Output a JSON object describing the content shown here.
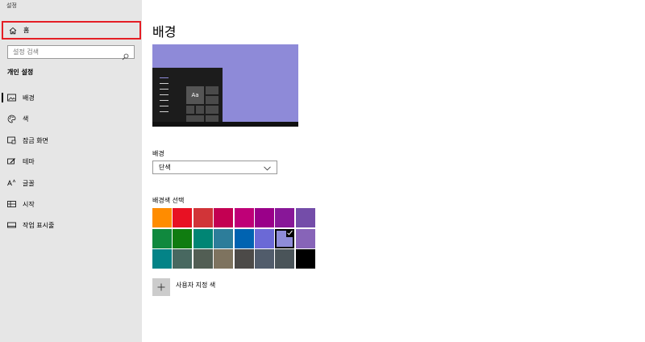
{
  "app": {
    "title": "설정"
  },
  "sidebar": {
    "home_label": "홈",
    "search_placeholder": "설정 검색",
    "section_title": "개인 설정",
    "items": [
      {
        "label": "배경",
        "icon": "picture-icon",
        "active": true
      },
      {
        "label": "색",
        "icon": "palette-icon",
        "active": false
      },
      {
        "label": "잠금 화면",
        "icon": "lock-screen-icon",
        "active": false
      },
      {
        "label": "테마",
        "icon": "theme-icon",
        "active": false
      },
      {
        "label": "글꼴",
        "icon": "font-icon",
        "active": false
      },
      {
        "label": "시작",
        "icon": "start-icon",
        "active": false
      },
      {
        "label": "작업 표시줄",
        "icon": "taskbar-icon",
        "active": false
      }
    ]
  },
  "main": {
    "title": "배경",
    "preview": {
      "sample_text": "Aa",
      "background_color": "#8e8ad8"
    },
    "background": {
      "label": "배경",
      "selected_value": "단색"
    },
    "color_choice": {
      "label": "배경색 선택",
      "colors": [
        "#ff8c00",
        "#e81123",
        "#d13438",
        "#c30052",
        "#bf0077",
        "#9a0089",
        "#881798",
        "#744da9",
        "#10893e",
        "#107c10",
        "#018574",
        "#2d7d9a",
        "#0063b1",
        "#6b69d6",
        "#8e8cd8",
        "#8764b8",
        "#038387",
        "#486860",
        "#525e54",
        "#7e735f",
        "#4c4a48",
        "#515c6b",
        "#4a5459",
        "#000000"
      ],
      "selected_index": 14,
      "custom_label": "사용자 지정 색"
    }
  }
}
